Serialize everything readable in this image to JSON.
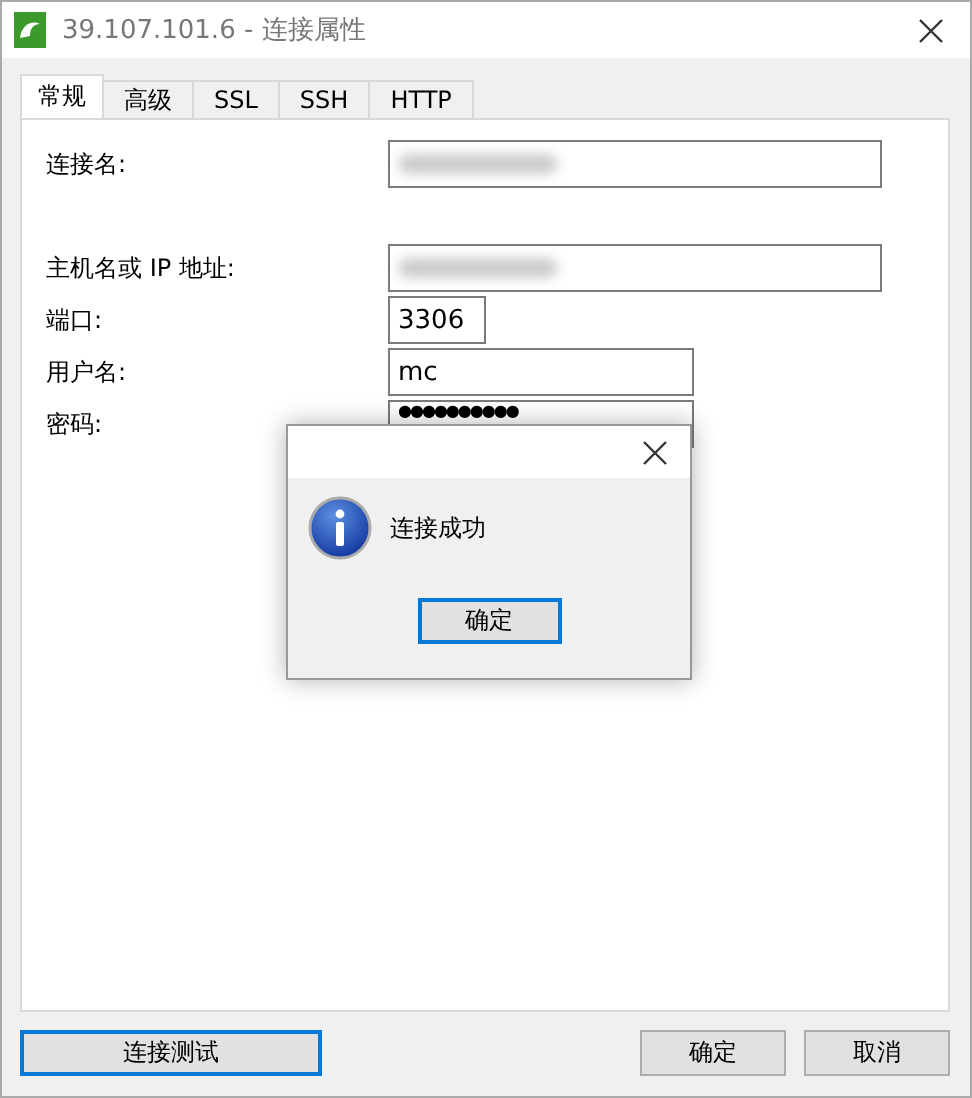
{
  "window": {
    "title": "39.107.101.6 - 连接属性"
  },
  "tabs": [
    {
      "label": "常规",
      "selected": true
    },
    {
      "label": "高级",
      "selected": false
    },
    {
      "label": "SSL",
      "selected": false
    },
    {
      "label": "SSH",
      "selected": false
    },
    {
      "label": "HTTP",
      "selected": false
    }
  ],
  "fields": [
    {
      "label": "连接名:",
      "kind": "blurred"
    },
    {
      "label": "主机名或 IP 地址:",
      "kind": "blurred"
    },
    {
      "label": "端口:",
      "kind": "text",
      "value": "3306"
    },
    {
      "label": "用户名:",
      "kind": "text",
      "value": "mc"
    },
    {
      "label": "密码:",
      "kind": "password",
      "value": "●●●●●●●●●●"
    }
  ],
  "dialog": {
    "message": "连接成功",
    "button": "确定"
  },
  "buttons": [
    {
      "label": "连接测试",
      "focused": true
    },
    {
      "label": "确定",
      "focused": false
    },
    {
      "label": "取消",
      "focused": false
    }
  ]
}
